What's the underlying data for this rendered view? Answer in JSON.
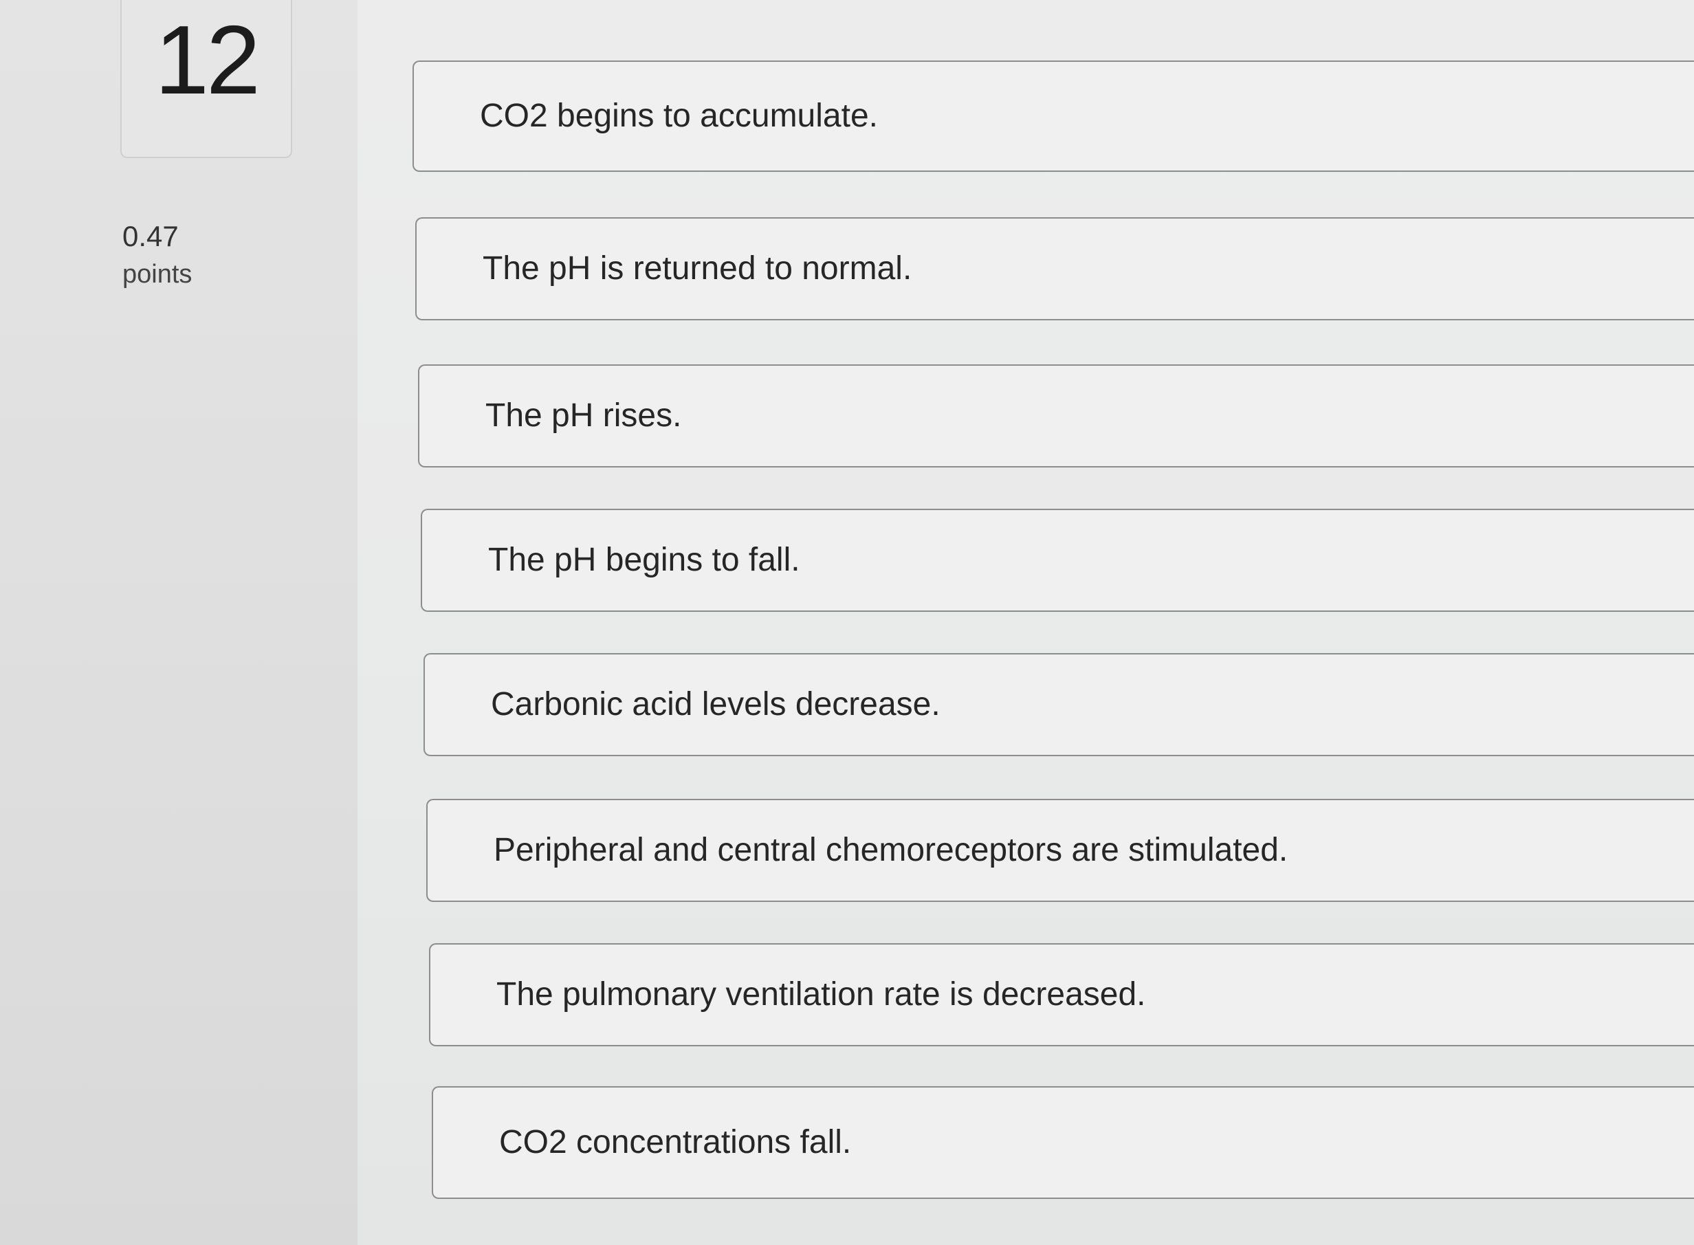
{
  "question": {
    "number": "12",
    "points_value": "0.47",
    "points_label": "points"
  },
  "answers": [
    {
      "label": "CO2 begins to accumulate."
    },
    {
      "label": "The pH is returned to normal."
    },
    {
      "label": "The pH rises."
    },
    {
      "label": "The pH begins to fall."
    },
    {
      "label": "Carbonic acid levels decrease."
    },
    {
      "label": "Peripheral and central chemoreceptors are stimulated."
    },
    {
      "label": "The pulmonary ventilation rate is decreased."
    },
    {
      "label": "CO2 concentrations fall."
    }
  ]
}
